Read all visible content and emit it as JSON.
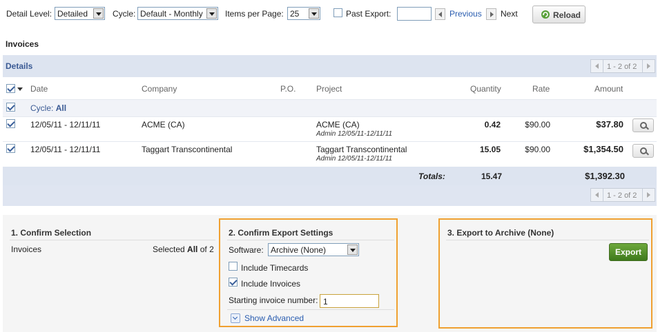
{
  "toolbar": {
    "detail_level_label": "Detail Level:",
    "detail_level_value": "Detailed",
    "cycle_label": "Cycle:",
    "cycle_value": "Default - Monthly",
    "items_per_page_label": "Items per Page:",
    "items_per_page_value": "25",
    "past_export_label": "Past Export:",
    "past_export_value": "",
    "previous_label": "Previous",
    "next_label": "Next",
    "reload_label": "Reload"
  },
  "section_title": "Invoices",
  "details": {
    "title": "Details",
    "pager_text": "1 - 2 of 2"
  },
  "table": {
    "headers": {
      "date": "Date",
      "company": "Company",
      "po": "P.O.",
      "project": "Project",
      "quantity": "Quantity",
      "rate": "Rate",
      "amount": "Amount"
    },
    "cycle_label": "Cycle:",
    "cycle_value": "All",
    "rows": [
      {
        "date": "12/05/11 - 12/11/11",
        "company": "ACME (CA)",
        "po": "",
        "project": "ACME (CA)",
        "project_sub": "Admin 12/05/11-12/11/11",
        "quantity": "0.42",
        "rate": "$90.00",
        "amount": "$37.80"
      },
      {
        "date": "12/05/11 - 12/11/11",
        "company": "Taggart Transcontinental",
        "po": "",
        "project": "Taggart Transcontinental",
        "project_sub": "Admin 12/05/11-12/11/11",
        "quantity": "15.05",
        "rate": "$90.00",
        "amount": "$1,354.50"
      }
    ],
    "totals_label": "Totals:",
    "totals_quantity": "15.47",
    "totals_amount": "$1,392.30"
  },
  "confirm_selection": {
    "title": "1. Confirm Selection",
    "item_label": "Invoices",
    "selected_prefix": "Selected",
    "selected_all": "All",
    "selected_suffix": "of 2"
  },
  "export_settings": {
    "title": "2. Confirm Export Settings",
    "software_label": "Software:",
    "software_value": "Archive (None)",
    "include_timecards_label": "Include Timecards",
    "include_timecards_checked": false,
    "include_invoices_label": "Include Invoices",
    "include_invoices_checked": true,
    "starting_invoice_label": "Starting invoice number:",
    "starting_invoice_value": "1",
    "show_advanced_label": "Show Advanced"
  },
  "export_archive": {
    "title": "3. Export to Archive (None)",
    "export_label": "Export"
  },
  "colors": {
    "band": "#dde4f0",
    "link": "#2a5db0",
    "highlight_border": "#f0a030",
    "export_green": "#4e8a28"
  }
}
